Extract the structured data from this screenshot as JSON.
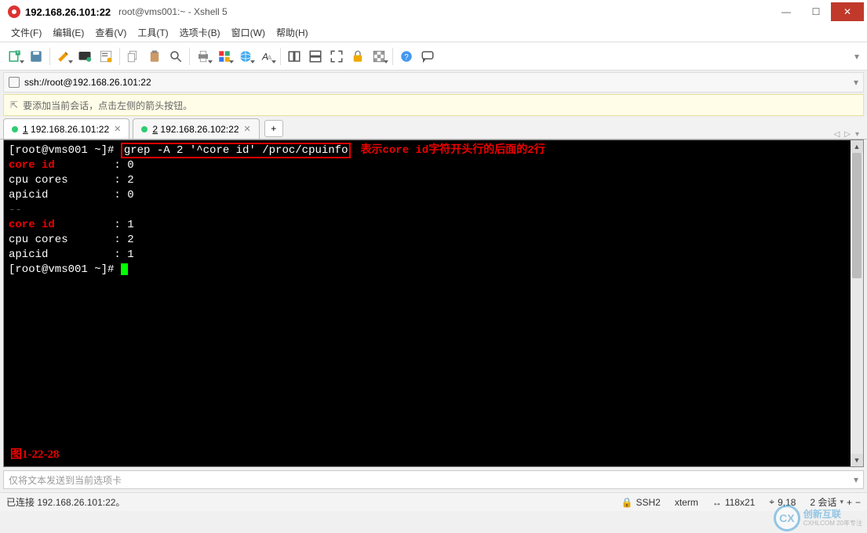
{
  "titlebar": {
    "ip": "192.168.26.101:22",
    "rest": "root@vms001:~ - Xshell 5"
  },
  "menu": {
    "file": "文件(F)",
    "edit": "编辑(E)",
    "view": "查看(V)",
    "tools": "工具(T)",
    "tabs": "选项卡(B)",
    "window": "窗口(W)",
    "help": "帮助(H)"
  },
  "toolbar_icons": [
    "new-session-icon",
    "save-icon",
    "edit-script-icon",
    "terminal-icon",
    "properties-icon",
    "copy-icon",
    "paste-icon",
    "search-icon",
    "print-icon",
    "color-icon",
    "globe-icon",
    "font-icon",
    "tile-h-icon",
    "tile-v-icon",
    "fullscreen-icon",
    "lock-icon",
    "transparency-icon",
    "help-icon",
    "chat-icon"
  ],
  "address": {
    "url": "ssh://root@192.168.26.101:22"
  },
  "hint": {
    "text": "要添加当前会话，点击左侧的箭头按钮。"
  },
  "tabs": [
    {
      "num": "1",
      "label": "192.168.26.101:22",
      "active": true
    },
    {
      "num": "2",
      "label": "192.168.26.102:22",
      "active": false
    }
  ],
  "terminal": {
    "prompt": "[root@vms001 ~]#",
    "command": "grep -A 2 '^core id' /proc/cpuinfo",
    "annotation": "表示core id字符开头行的后面的2行",
    "lines": [
      {
        "type": "match",
        "key": "core id",
        "val": "0"
      },
      {
        "type": "ctx",
        "key": "cpu cores",
        "val": "2"
      },
      {
        "type": "ctx",
        "key": "apicid",
        "val": "0"
      },
      {
        "type": "sep",
        "text": "--"
      },
      {
        "type": "match",
        "key": "core id",
        "val": "1"
      },
      {
        "type": "ctx",
        "key": "cpu cores",
        "val": "2"
      },
      {
        "type": "ctx",
        "key": "apicid",
        "val": "1"
      }
    ],
    "figure": "图1-22-28"
  },
  "bottom_input": {
    "placeholder": "仅将文本发送到当前选项卡"
  },
  "status": {
    "conn": "已连接 192.168.26.101:22。",
    "ssh": "SSH2",
    "term": "xterm",
    "size": "118x21",
    "pos": "9,18",
    "sessions": "2 会话",
    "lock_icon": "🔒",
    "resize_icon": "↔",
    "caret_icon": "⌖",
    "plus_icon": "+ ",
    "dd": "▾"
  },
  "watermark": {
    "main": "创新互联",
    "sub": "CXHLCOM 20年专注"
  }
}
